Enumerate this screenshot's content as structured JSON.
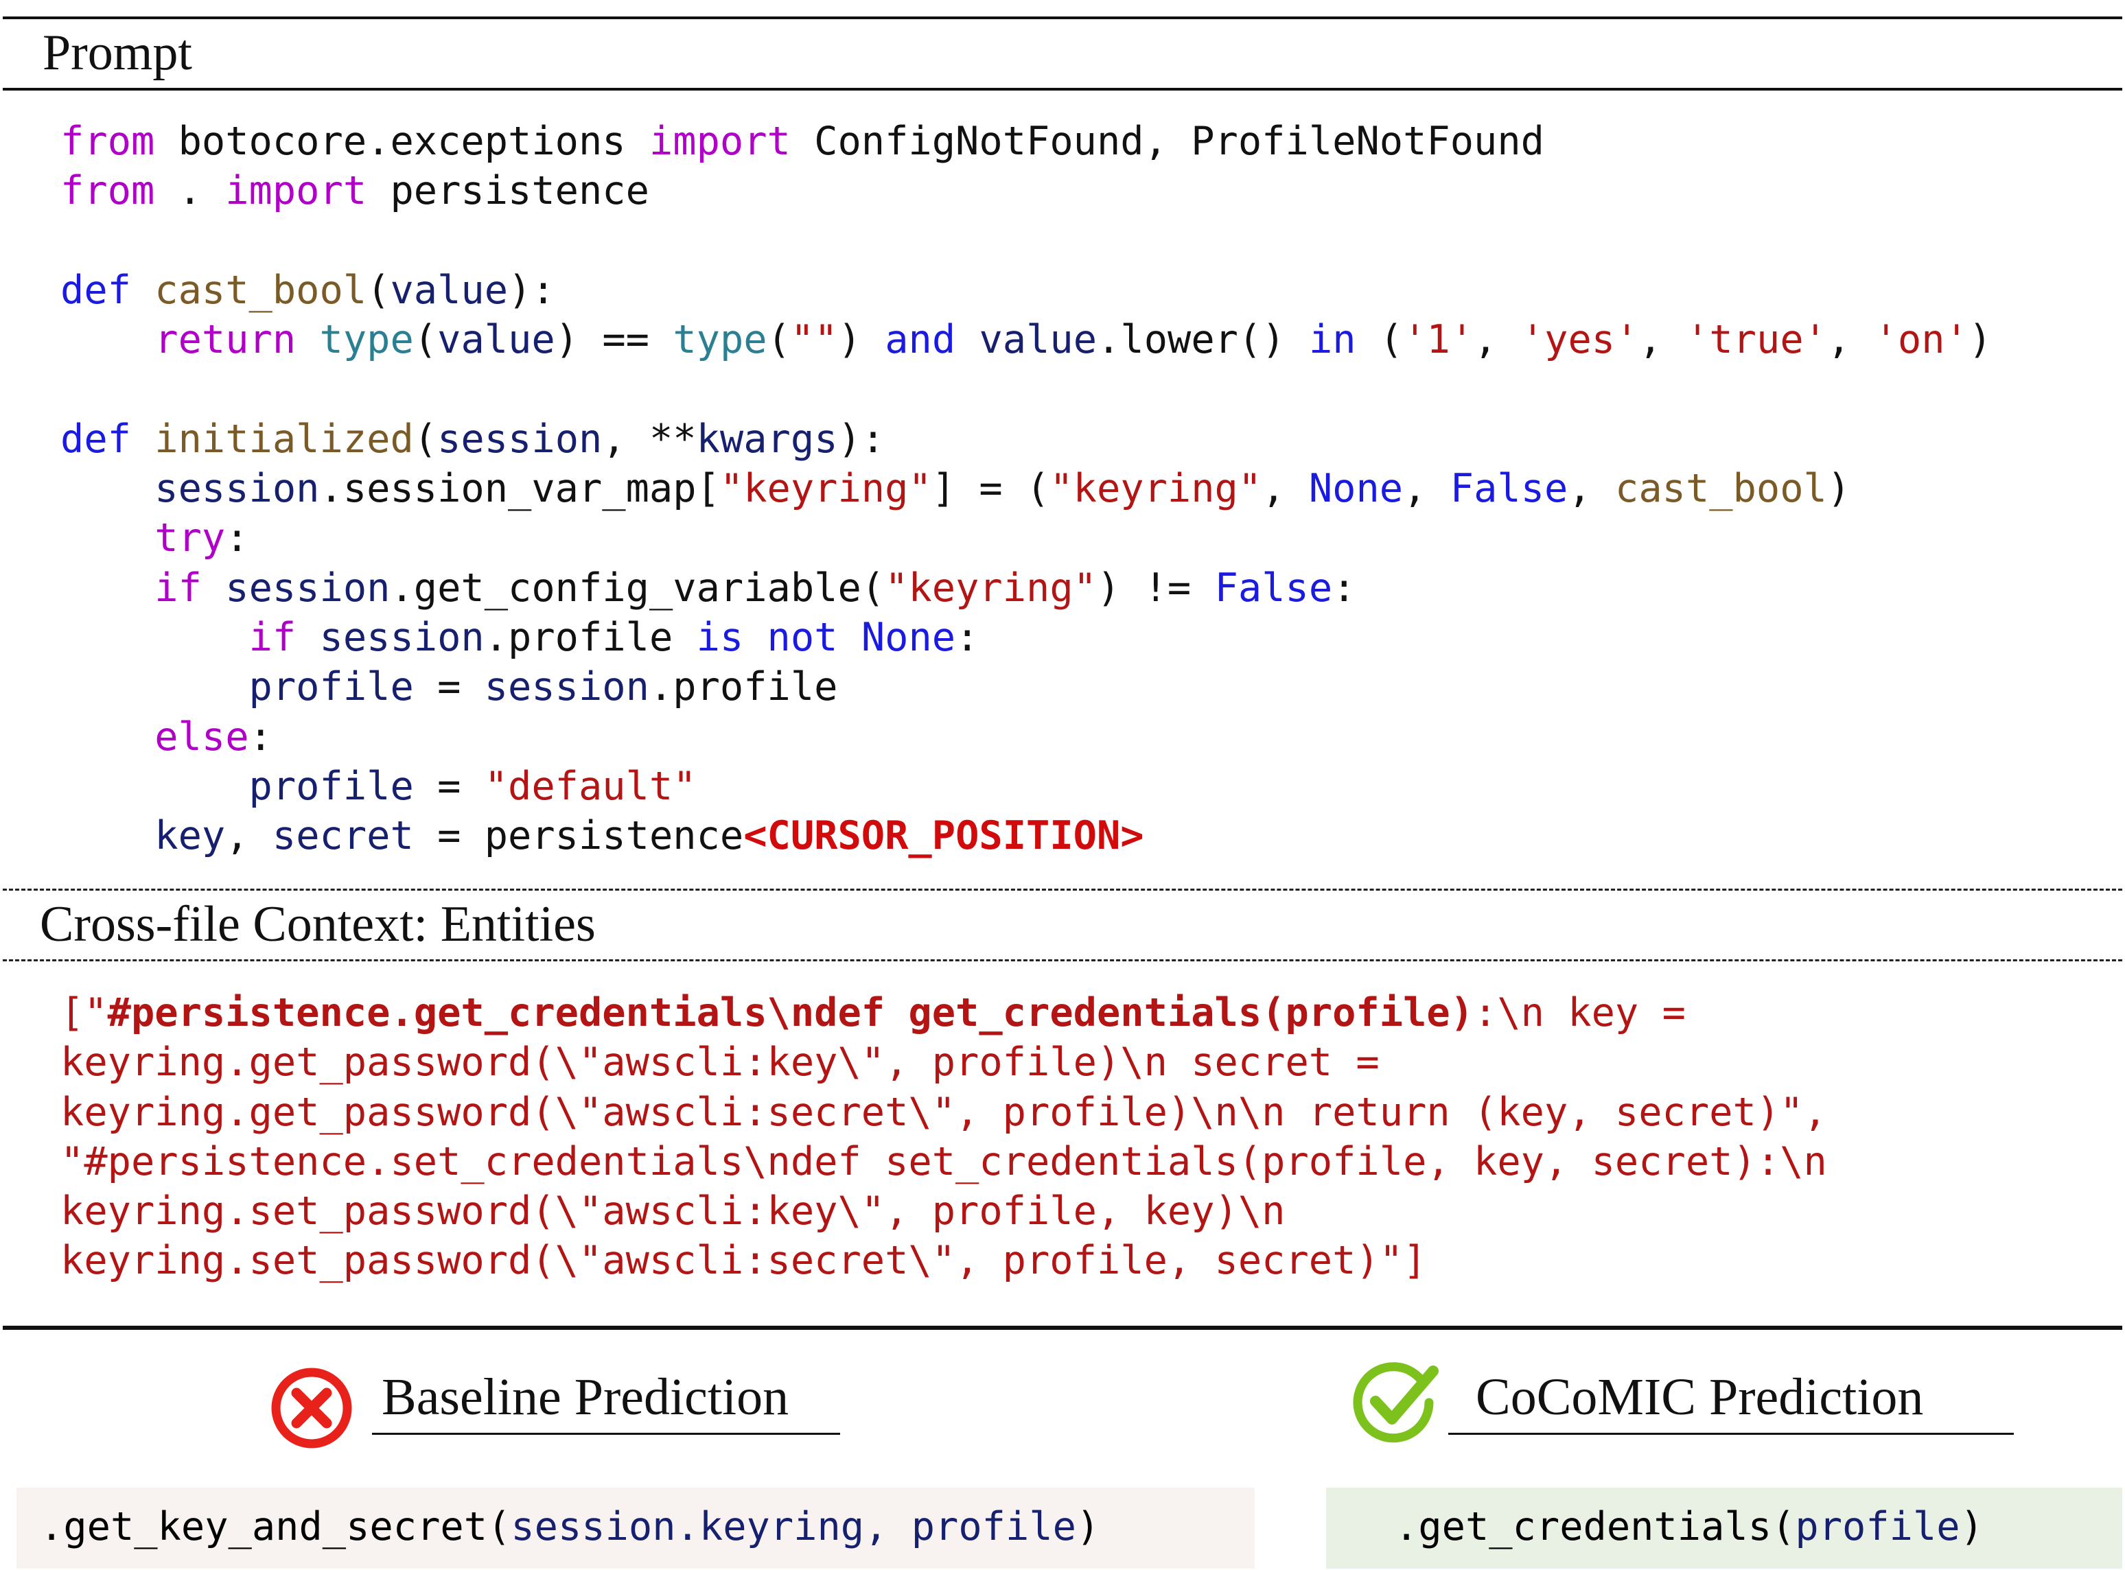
{
  "prompt_heading": "Prompt",
  "code_lines": [
    {
      "tokens": [
        {
          "t": "from",
          "c": "kw"
        },
        {
          "t": " botocore.exceptions ",
          "c": ""
        },
        {
          "t": "import",
          "c": "kw"
        },
        {
          "t": " ConfigNotFound, ProfileNotFound",
          "c": ""
        }
      ]
    },
    {
      "tokens": [
        {
          "t": "from",
          "c": "kw"
        },
        {
          "t": " . ",
          "c": ""
        },
        {
          "t": "import",
          "c": "kw"
        },
        {
          "t": " persistence",
          "c": ""
        }
      ]
    },
    {
      "tokens": []
    },
    {
      "tokens": [
        {
          "t": "def",
          "c": "kw2"
        },
        {
          "t": " ",
          "c": ""
        },
        {
          "t": "cast_bool",
          "c": "fn"
        },
        {
          "t": "(",
          "c": ""
        },
        {
          "t": "value",
          "c": "var"
        },
        {
          "t": "):",
          "c": ""
        }
      ]
    },
    {
      "tokens": [
        {
          "t": "    ",
          "c": ""
        },
        {
          "t": "return",
          "c": "kw"
        },
        {
          "t": " ",
          "c": ""
        },
        {
          "t": "type",
          "c": "bi"
        },
        {
          "t": "(",
          "c": ""
        },
        {
          "t": "value",
          "c": "var"
        },
        {
          "t": ") == ",
          "c": ""
        },
        {
          "t": "type",
          "c": "bi"
        },
        {
          "t": "(",
          "c": ""
        },
        {
          "t": "\"\"",
          "c": "str"
        },
        {
          "t": ") ",
          "c": ""
        },
        {
          "t": "and",
          "c": "kw2"
        },
        {
          "t": " ",
          "c": ""
        },
        {
          "t": "value",
          "c": "var"
        },
        {
          "t": ".lower() ",
          "c": ""
        },
        {
          "t": "in",
          "c": "kw2"
        },
        {
          "t": " (",
          "c": ""
        },
        {
          "t": "'1'",
          "c": "str"
        },
        {
          "t": ", ",
          "c": ""
        },
        {
          "t": "'yes'",
          "c": "str"
        },
        {
          "t": ", ",
          "c": ""
        },
        {
          "t": "'true'",
          "c": "str"
        },
        {
          "t": ", ",
          "c": ""
        },
        {
          "t": "'on'",
          "c": "str"
        },
        {
          "t": ")",
          "c": ""
        }
      ]
    },
    {
      "tokens": []
    },
    {
      "tokens": [
        {
          "t": "def",
          "c": "kw2"
        },
        {
          "t": " ",
          "c": ""
        },
        {
          "t": "initialized",
          "c": "fn"
        },
        {
          "t": "(",
          "c": ""
        },
        {
          "t": "session",
          "c": "var"
        },
        {
          "t": ", **",
          "c": ""
        },
        {
          "t": "kwargs",
          "c": "var"
        },
        {
          "t": "):",
          "c": ""
        }
      ]
    },
    {
      "tokens": [
        {
          "t": "    ",
          "c": ""
        },
        {
          "t": "session",
          "c": "var"
        },
        {
          "t": ".session_var_map[",
          "c": ""
        },
        {
          "t": "\"keyring\"",
          "c": "str"
        },
        {
          "t": "] = (",
          "c": ""
        },
        {
          "t": "\"keyring\"",
          "c": "str"
        },
        {
          "t": ", ",
          "c": ""
        },
        {
          "t": "None",
          "c": "kw2"
        },
        {
          "t": ", ",
          "c": ""
        },
        {
          "t": "False",
          "c": "kw2"
        },
        {
          "t": ", ",
          "c": ""
        },
        {
          "t": "cast_bool",
          "c": "fn"
        },
        {
          "t": ")",
          "c": ""
        }
      ]
    },
    {
      "tokens": [
        {
          "t": "    ",
          "c": ""
        },
        {
          "t": "try",
          "c": "kw"
        },
        {
          "t": ":",
          "c": ""
        }
      ]
    },
    {
      "tokens": [
        {
          "t": "    ",
          "c": ""
        },
        {
          "t": "if",
          "c": "kw"
        },
        {
          "t": " ",
          "c": ""
        },
        {
          "t": "session",
          "c": "var"
        },
        {
          "t": ".get_config_variable(",
          "c": ""
        },
        {
          "t": "\"keyring\"",
          "c": "str"
        },
        {
          "t": ") != ",
          "c": ""
        },
        {
          "t": "False",
          "c": "kw2"
        },
        {
          "t": ":",
          "c": ""
        }
      ]
    },
    {
      "tokens": [
        {
          "t": "        ",
          "c": ""
        },
        {
          "t": "if",
          "c": "kw"
        },
        {
          "t": " ",
          "c": ""
        },
        {
          "t": "session",
          "c": "var"
        },
        {
          "t": ".profile ",
          "c": ""
        },
        {
          "t": "is not",
          "c": "kw2"
        },
        {
          "t": " ",
          "c": ""
        },
        {
          "t": "None",
          "c": "kw2"
        },
        {
          "t": ":",
          "c": ""
        }
      ]
    },
    {
      "tokens": [
        {
          "t": "        ",
          "c": ""
        },
        {
          "t": "profile",
          "c": "var"
        },
        {
          "t": " = ",
          "c": ""
        },
        {
          "t": "session",
          "c": "var"
        },
        {
          "t": ".profile",
          "c": ""
        }
      ]
    },
    {
      "tokens": [
        {
          "t": "    ",
          "c": ""
        },
        {
          "t": "else",
          "c": "kw"
        },
        {
          "t": ":",
          "c": ""
        }
      ]
    },
    {
      "tokens": [
        {
          "t": "        ",
          "c": ""
        },
        {
          "t": "profile",
          "c": "var"
        },
        {
          "t": " = ",
          "c": ""
        },
        {
          "t": "\"default\"",
          "c": "str"
        }
      ]
    },
    {
      "tokens": [
        {
          "t": "    ",
          "c": ""
        },
        {
          "t": "key",
          "c": "var"
        },
        {
          "t": ", ",
          "c": ""
        },
        {
          "t": "secret",
          "c": "var"
        },
        {
          "t": " = persistence",
          "c": ""
        },
        {
          "t": "<CURSOR_POSITION>",
          "c": "cursor"
        }
      ]
    }
  ],
  "context_heading": "Cross-file Context: Entities",
  "context_lines": [
    {
      "tokens": [
        {
          "t": "[\"",
          "c": ""
        },
        {
          "t": "#persistence.get_credentials\\ndef get_credentials(profile)",
          "c": "bold"
        },
        {
          "t": ":\\n key =",
          "c": ""
        }
      ]
    },
    {
      "tokens": [
        {
          "t": "keyring.get_password(\\\"awscli:key\\\", profile)\\n secret =",
          "c": ""
        }
      ]
    },
    {
      "tokens": [
        {
          "t": "keyring.get_password(\\\"awscli:secret\\\", profile)\\n\\n return (key, secret)\",",
          "c": ""
        }
      ]
    },
    {
      "tokens": [
        {
          "t": "\"#persistence.set_credentials\\ndef set_credentials(profile, key, secret):\\n",
          "c": ""
        }
      ]
    },
    {
      "tokens": [
        {
          "t": "keyring.set_password(\\\"awscli:key\\\", profile, key)\\n",
          "c": ""
        }
      ]
    },
    {
      "tokens": [
        {
          "t": "keyring.set_password(\\\"awscli:secret\\\", profile, secret)\"]",
          "c": ""
        }
      ]
    }
  ],
  "baseline": {
    "title": "Baseline Prediction",
    "icon": "cross-circle-icon",
    "icon_color": "#e8211a",
    "box_color": "#f8f3f1",
    "code": [
      {
        "t": ".get_key_and_secret(",
        "c": ""
      },
      {
        "t": "session",
        "c": "var"
      },
      {
        "t": ".keyring, ",
        "c": "var"
      },
      {
        "t": "profile",
        "c": "var"
      },
      {
        "t": ")",
        "c": ""
      }
    ]
  },
  "cocomic": {
    "title": "CoCoMIC Prediction",
    "icon": "check-circle-icon",
    "icon_color": "#7cc11c",
    "box_color": "#e8f1e4",
    "code": [
      {
        "t": ".get_credentials(",
        "c": ""
      },
      {
        "t": "profile",
        "c": "var"
      },
      {
        "t": ")",
        "c": ""
      }
    ]
  }
}
